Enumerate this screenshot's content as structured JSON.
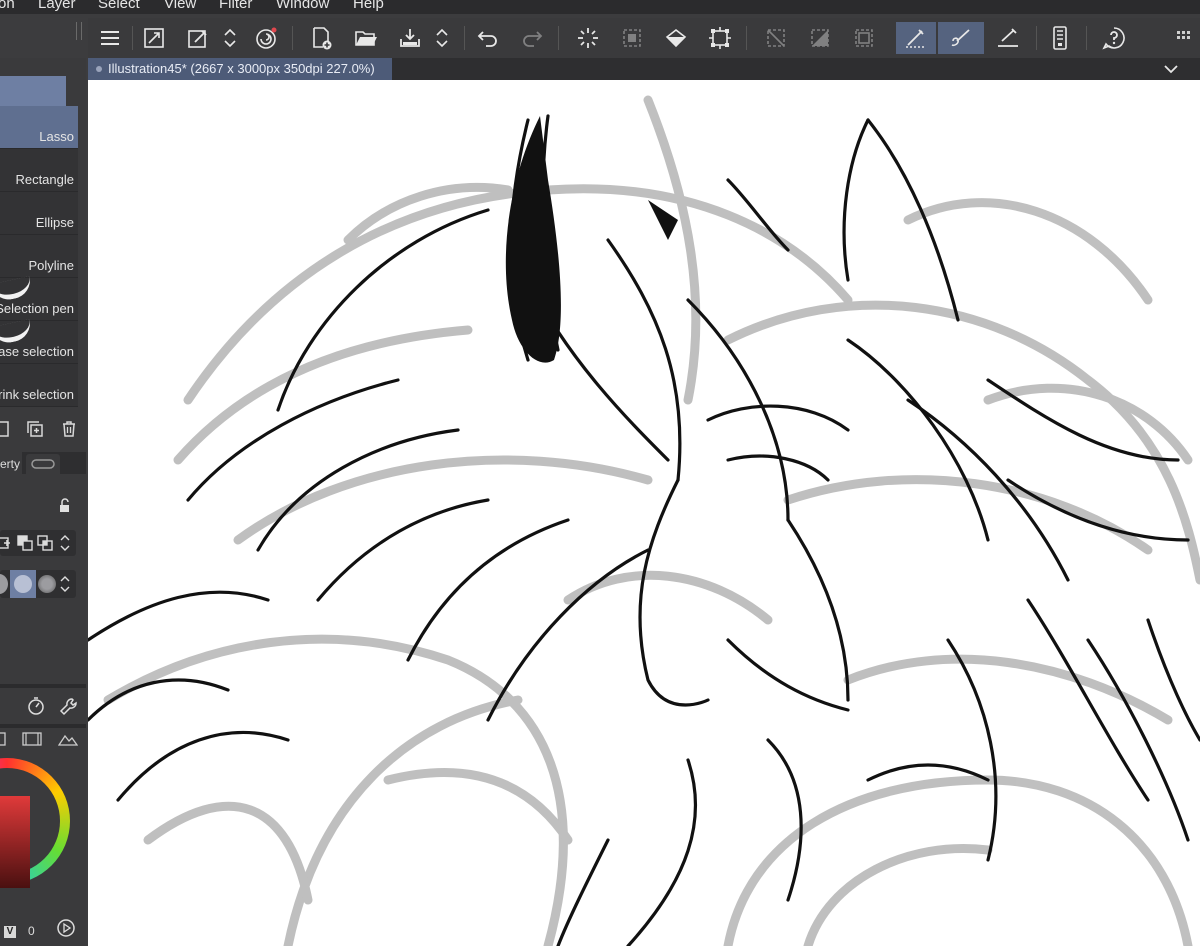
{
  "menubar": {
    "items": [
      "on",
      "Layer",
      "Select",
      "View",
      "Filter",
      "Window",
      "Help"
    ]
  },
  "document": {
    "tab_title": "Illustration45* (2667 x 3000px 350dpi 227.0%)"
  },
  "sub_tools": {
    "items": [
      {
        "label": "Lasso",
        "selected": true
      },
      {
        "label": "Rectangle",
        "selected": false
      },
      {
        "label": "Ellipse",
        "selected": false
      },
      {
        "label": "Polyline",
        "selected": false
      },
      {
        "label": "Selection pen",
        "selected": false
      },
      {
        "label": "ase selection",
        "selected": false
      },
      {
        "label": "rink selection",
        "selected": false
      }
    ]
  },
  "tool_property": {
    "tab_label": "erty"
  },
  "color": {
    "main": "#e03a3a",
    "value_label": "0",
    "v_badge": "V"
  },
  "theme": {
    "accent": "#55637f",
    "tab_active": "#4d5b78",
    "panel_bg": "#3a3a3c"
  },
  "toolbar": {
    "icons": [
      "menu-icon",
      "resize-icon",
      "eyedropper-icon",
      "spinner-icon",
      "spiral-icon",
      "new-file-icon",
      "open-folder-icon",
      "save-icon",
      "spinner-icon",
      "undo-icon",
      "redo-icon",
      "loading-icon",
      "deselect-icon",
      "fill-icon",
      "transform-icon",
      "clear-icon",
      "invert-icon",
      "border-icon",
      "pen-icon",
      "brush-icon",
      "draw-line-icon",
      "tablet-icon",
      "help-icon"
    ]
  }
}
